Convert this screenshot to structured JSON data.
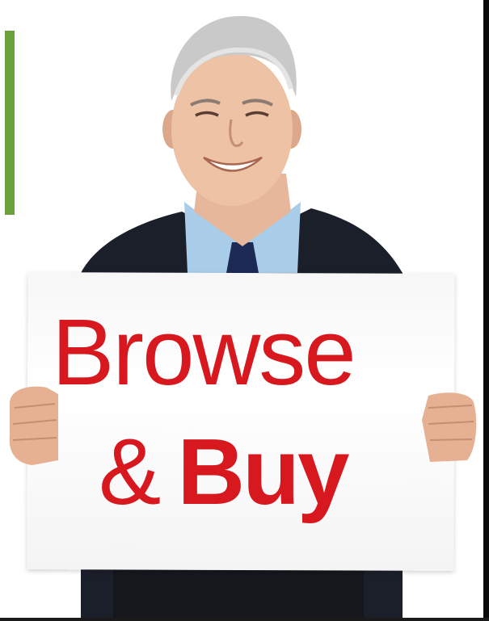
{
  "sign": {
    "line1": "Browse",
    "line2_amp": "&",
    "line2_buy": "Buy"
  },
  "colors": {
    "sign_text": "#d7191f",
    "accent_bar": "#6aa13a",
    "suit": "#1b1f2a",
    "shirt": "#a9cde8",
    "tie": "#1c2a55"
  },
  "icons": {
    "accent": "green-vertical-bar"
  }
}
